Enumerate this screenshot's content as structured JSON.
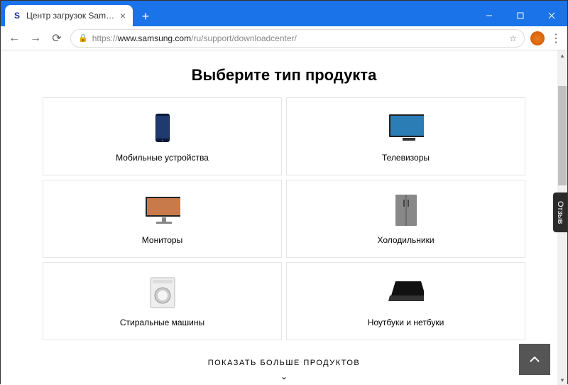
{
  "browser": {
    "tab_favicon_letter": "S",
    "tab_title": "Центр загрузок Samsung: драй...",
    "url_prefix": "https://",
    "url_host": "www.samsung.com",
    "url_path": "/ru/support/downloadcenter/"
  },
  "page": {
    "heading": "Выберите тип продукта",
    "products": [
      {
        "label": "Мобильные устройства",
        "icon": "phone"
      },
      {
        "label": "Телевизоры",
        "icon": "tv"
      },
      {
        "label": "Мониторы",
        "icon": "monitor"
      },
      {
        "label": "Холодильники",
        "icon": "fridge"
      },
      {
        "label": "Стиральные машины",
        "icon": "washer"
      },
      {
        "label": "Ноутбуки и нетбуки",
        "icon": "laptop"
      }
    ],
    "show_more": "ПОКАЗАТЬ БОЛЬШЕ ПРОДУКТОВ",
    "feedback_label": "Отзыв"
  }
}
